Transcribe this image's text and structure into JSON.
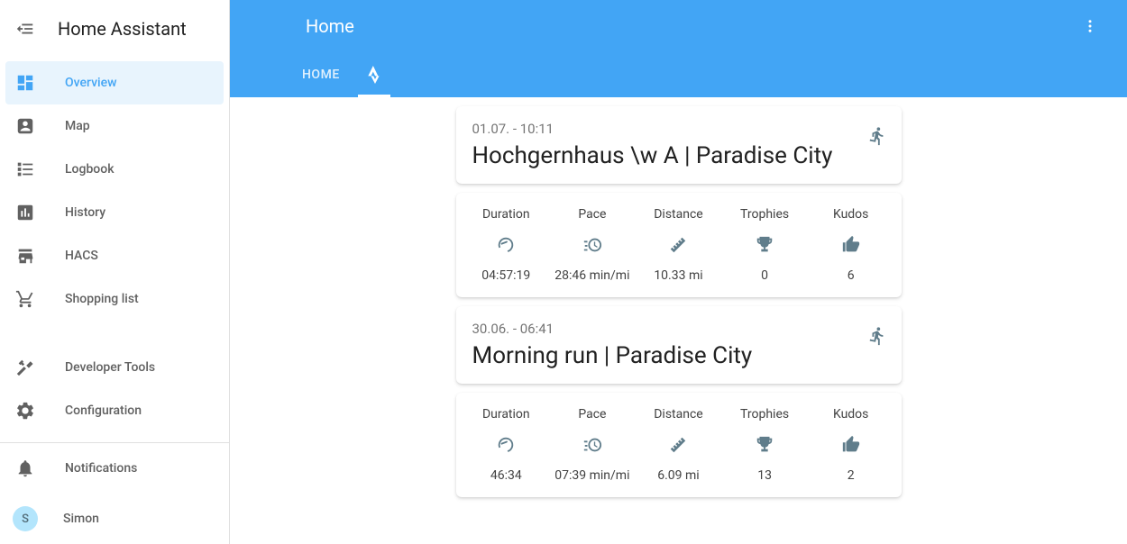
{
  "app": {
    "title": "Home Assistant"
  },
  "sidebar": {
    "items": [
      {
        "label": "Overview"
      },
      {
        "label": "Map"
      },
      {
        "label": "Logbook"
      },
      {
        "label": "History"
      },
      {
        "label": "HACS"
      },
      {
        "label": "Shopping list"
      },
      {
        "label": "Developer Tools"
      },
      {
        "label": "Configuration"
      }
    ],
    "bottom": {
      "notifications": "Notifications",
      "user_name": "Simon",
      "user_initial": "S"
    }
  },
  "header": {
    "title": "Home",
    "tabs": [
      {
        "label": "HOME"
      }
    ]
  },
  "activities": [
    {
      "date": "01.07. - 10:11",
      "title": "Hochgernhaus \\w A | Paradise City",
      "stats": {
        "duration_label": "Duration",
        "duration_value": "04:57:19",
        "pace_label": "Pace",
        "pace_value": "28:46 min/mi",
        "distance_label": "Distance",
        "distance_value": "10.33 mi",
        "trophies_label": "Trophies",
        "trophies_value": "0",
        "kudos_label": "Kudos",
        "kudos_value": "6"
      }
    },
    {
      "date": "30.06. - 06:41",
      "title": "Morning run | Paradise City",
      "stats": {
        "duration_label": "Duration",
        "duration_value": "46:34",
        "pace_label": "Pace",
        "pace_value": "07:39 min/mi",
        "distance_label": "Distance",
        "distance_value": "6.09 mi",
        "trophies_label": "Trophies",
        "trophies_value": "13",
        "kudos_label": "Kudos",
        "kudos_value": "2"
      }
    }
  ]
}
